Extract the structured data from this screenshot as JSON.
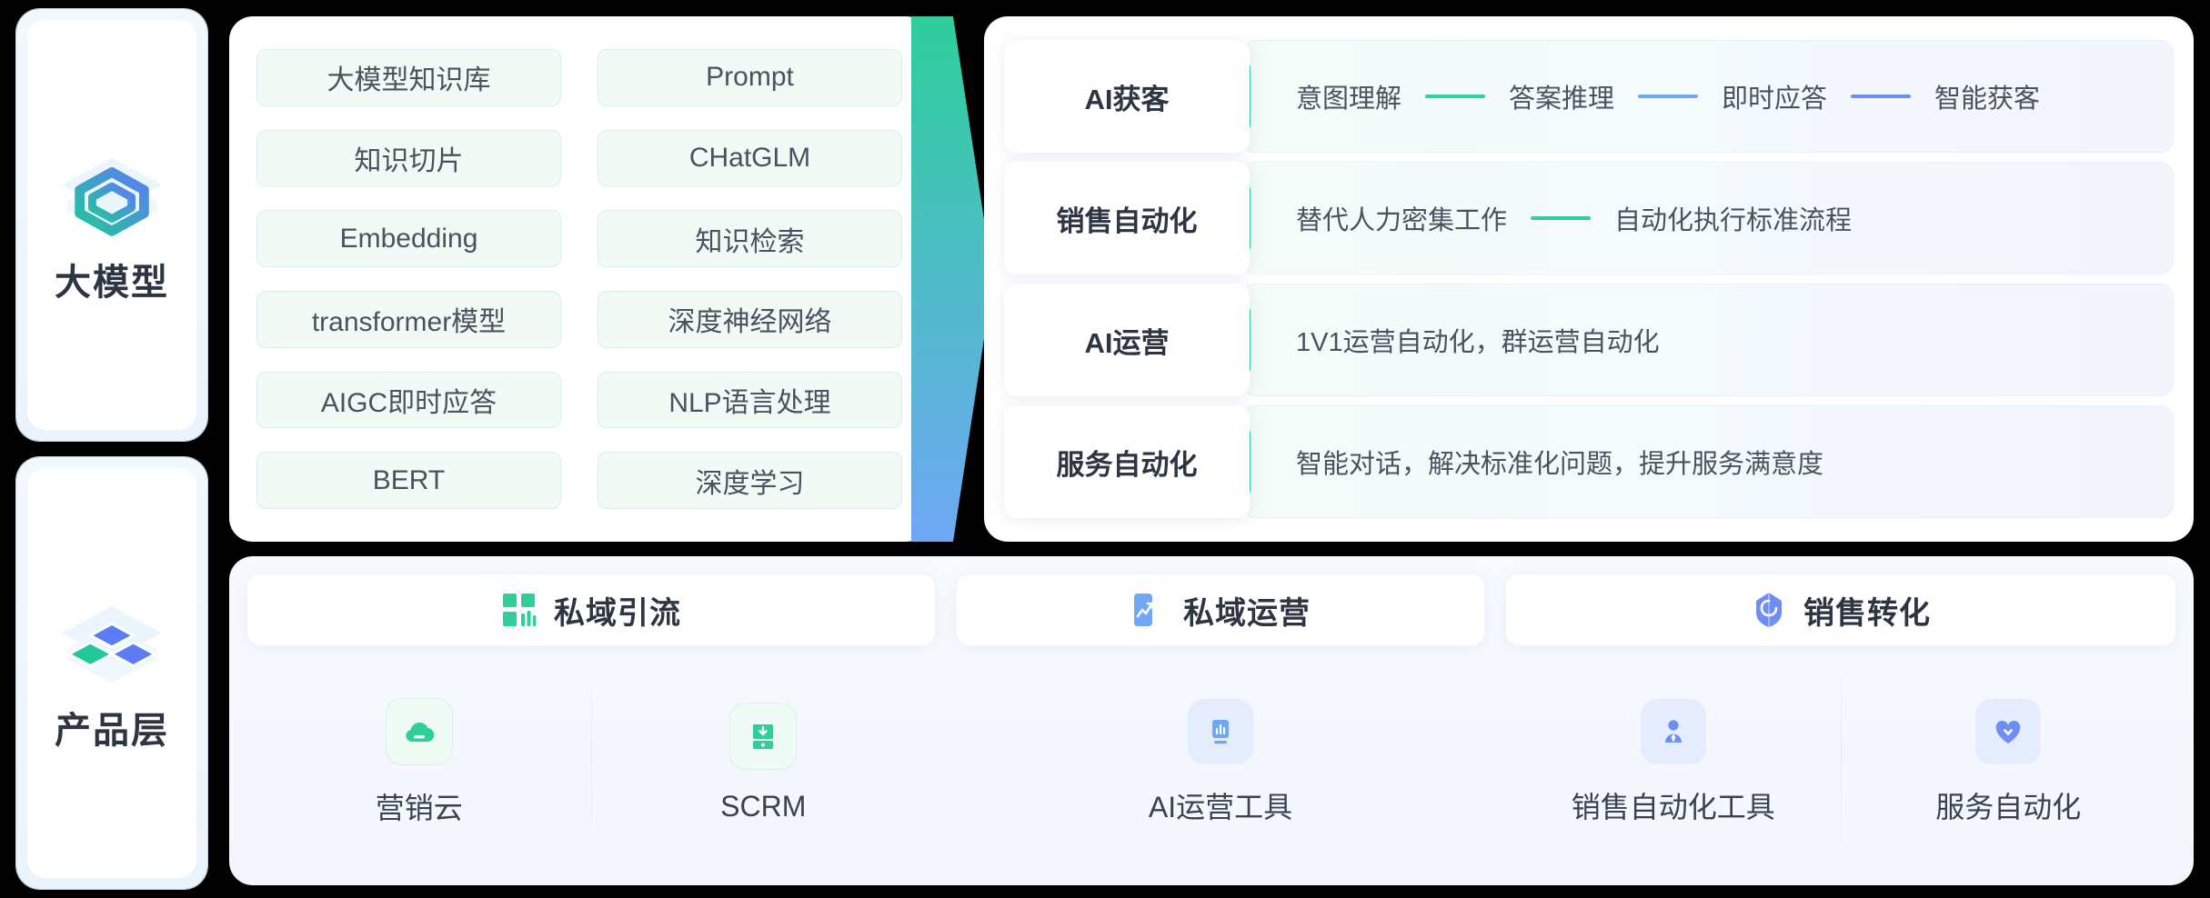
{
  "colors": {
    "accent_green": "#2ecf9b",
    "accent_blue": "#6fa8f5",
    "accent_indigo": "#6f8ef5",
    "tag_bg": "#f1faf5",
    "panel_bg": "#ffffff"
  },
  "rail": {
    "items": [
      {
        "label": "大模型",
        "icon": "layered-cube-icon"
      },
      {
        "label": "产品层",
        "icon": "stacked-blocks-icon"
      }
    ]
  },
  "tags_panel": {
    "tags": [
      "大模型知识库",
      "Prompt",
      "知识切片",
      "CHatGLM",
      "Embedding",
      "知识检索",
      "transformer模型",
      "深度神经网络",
      "AIGC即时应答",
      "NLP语言处理",
      "BERT",
      "深度学习"
    ]
  },
  "capabilities": {
    "rows": [
      {
        "name": "AI获客",
        "items": [
          "意图理解",
          "答案推理",
          "即时应答",
          "智能获客"
        ],
        "connectors": [
          "#2ecf9b",
          "#6fa8f5",
          "#6f8ef5"
        ]
      },
      {
        "name": "销售自动化",
        "items": [
          "替代人力密集工作",
          "自动化执行标准流程"
        ],
        "connectors": [
          "#2ecf9b"
        ]
      },
      {
        "name": "AI运营",
        "items": [
          "1V1运营自动化，群运营自动化"
        ],
        "connectors": []
      },
      {
        "name": "服务自动化",
        "items": [
          "智能对话，解决标准化问题，提升服务满意度"
        ],
        "connectors": []
      }
    ]
  },
  "products": {
    "groups": [
      {
        "title": "私域引流",
        "head_icon": "grid-bars-icon",
        "head_icon_color": "#2ecf9b",
        "items": [
          {
            "label": "营销云",
            "icon": "cloud-icon",
            "style": "green"
          },
          {
            "label": "SCRM",
            "icon": "inbox-download-icon",
            "style": "green"
          }
        ]
      },
      {
        "title": "私域运营",
        "head_icon": "trend-chart-icon",
        "head_icon_color": "#6fa8f5",
        "items": [
          {
            "label": "AI运营工具",
            "icon": "bar-chart-phone-icon",
            "style": "blue"
          }
        ]
      },
      {
        "title": "销售转化",
        "head_icon": "shield-swirl-icon",
        "head_icon_color": "#6f8ef5",
        "items": [
          {
            "label": "销售自动化工具",
            "icon": "person-tie-icon",
            "style": "blue"
          },
          {
            "label": "服务自动化",
            "icon": "heart-check-icon",
            "style": "blue"
          }
        ]
      }
    ]
  }
}
